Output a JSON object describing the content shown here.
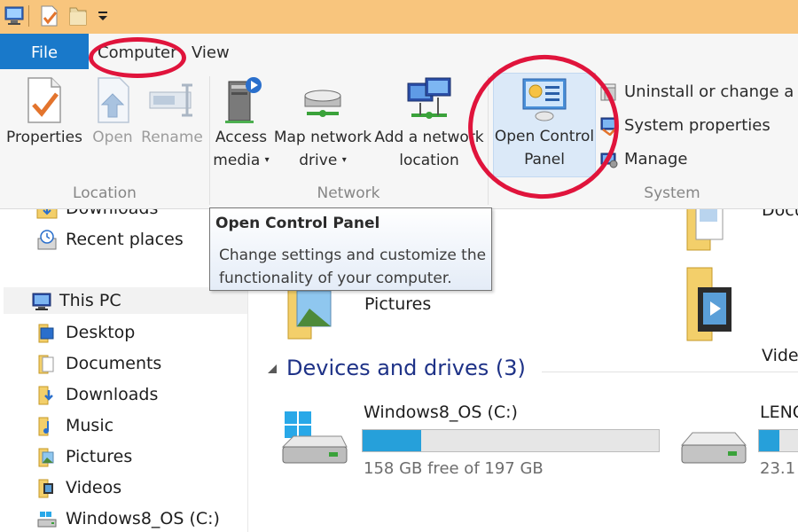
{
  "tabs": {
    "file": "File",
    "computer": "Computer",
    "view": "View"
  },
  "ribbon": {
    "location": {
      "label": "Location",
      "properties": "Properties",
      "open": "Open",
      "rename": "Rename"
    },
    "network": {
      "label": "Network",
      "access_media_line1": "Access",
      "access_media_line2": "media",
      "map_drive_line1": "Map network",
      "map_drive_line2": "drive",
      "add_location_line1": "Add a network",
      "add_location_line2": "location"
    },
    "system": {
      "label": "System",
      "open_control_panel_line1": "Open Control",
      "open_control_panel_line2": "Panel",
      "uninstall": "Uninstall or change a pr",
      "system_properties": "System properties",
      "manage": "Manage"
    }
  },
  "tooltip": {
    "title": "Open Control Panel",
    "body": "Change settings and customize the functionality of your computer."
  },
  "nav": {
    "downloads_top": "Downloads",
    "recent": "Recent places",
    "this_pc": "This PC",
    "desktop": "Desktop",
    "documents": "Documents",
    "downloads": "Downloads",
    "music": "Music",
    "pictures": "Pictures",
    "videos": "Videos",
    "os_drive": "Windows8_OS (C:)"
  },
  "content": {
    "documents_label": "Docu",
    "pictures_label": "Pictures",
    "videos_label": "Vide",
    "devices_header": "Devices and drives (3)",
    "drives": [
      {
        "name": "Windows8_OS (C:)",
        "free_text": "158 GB free of 197 GB",
        "used_fraction": 0.198
      },
      {
        "name": "LENO",
        "free_text": "23.1",
        "used_fraction": 0.3
      }
    ]
  },
  "colors": {
    "title_bar": "#f8c57d",
    "file_tab": "#1979ca",
    "annotation": "#e0143c",
    "drive_fill": "#26a0da"
  }
}
